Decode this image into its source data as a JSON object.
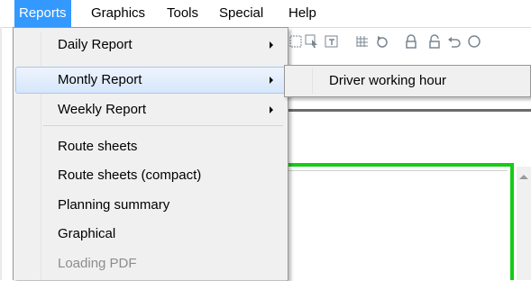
{
  "menubar": {
    "items": [
      {
        "label": "Reports"
      },
      {
        "label": "Graphics"
      },
      {
        "label": "Tools"
      },
      {
        "label": "Special"
      },
      {
        "label": "Help"
      }
    ]
  },
  "reports_menu": {
    "items": [
      {
        "label": "Daily Report"
      },
      {
        "label": "Montly Report"
      },
      {
        "label": "Weekly Report"
      },
      {
        "label": "Route sheets"
      },
      {
        "label": "Route sheets (compact)"
      },
      {
        "label": "Planning summary"
      },
      {
        "label": "Graphical"
      },
      {
        "label": "Loading PDF"
      }
    ]
  },
  "submenu": {
    "items": [
      {
        "label": "Driver working hour"
      }
    ]
  },
  "toolbar": {
    "icons": [
      "select-icon",
      "select-arrow-icon",
      "text-tool-icon",
      "grid-icon",
      "refresh-icon",
      "lock-icon",
      "unlock-icon",
      "undo-icon",
      "redo-icon"
    ]
  },
  "colors": {
    "menu_active": "#3399ff",
    "menu_bg": "#f0f0f0",
    "highlight_border": "#a9c7ee",
    "canvas_border": "#16cc16",
    "disabled_text": "#8c8c8c"
  }
}
